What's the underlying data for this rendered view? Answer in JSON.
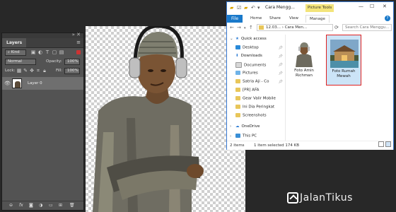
{
  "layers_panel": {
    "tab_label": "Layers",
    "kind_label": "Kind",
    "blend_mode": "Normal",
    "opacity_label": "Opacity:",
    "opacity_value": "100%",
    "lock_label": "Lock:",
    "fill_label": "Fill:",
    "fill_value": "100%",
    "layer_name": "Layer 0",
    "bottom_icons": [
      "link-icon",
      "fx-icon",
      "mask-icon",
      "adjustment-icon",
      "group-icon",
      "new-layer-icon",
      "trash-icon"
    ]
  },
  "explorer": {
    "title": "Cara Mengg...",
    "picture_tools": "Picture Tools",
    "tabs": [
      "File",
      "Home",
      "Share",
      "View",
      "Manage"
    ],
    "address": {
      "part1": "12.03...",
      "part2": "Cara Men..."
    },
    "search_placeholder": "Search Cara Menggu...",
    "nav_items": [
      {
        "label": "Quick access",
        "icon": "star-icon",
        "pinned": false
      },
      {
        "label": "Desktop",
        "icon": "desktop-icon",
        "pinned": true
      },
      {
        "label": "Downloads",
        "icon": "download-icon",
        "pinned": true
      },
      {
        "label": "Documents",
        "icon": "documents-icon",
        "pinned": true
      },
      {
        "label": "Pictures",
        "icon": "pictures-icon",
        "pinned": true
      },
      {
        "label": "Satria Aji - Co",
        "icon": "folder-icon",
        "pinned": true
      },
      {
        "label": "[PR] AFA",
        "icon": "folder-icon",
        "pinned": false
      },
      {
        "label": "Gear Valir Mobile",
        "icon": "folder-icon",
        "pinned": false
      },
      {
        "label": "Ini Dia Peringkat",
        "icon": "folder-icon",
        "pinned": false
      },
      {
        "label": "Screenshots",
        "icon": "folder-icon",
        "pinned": false
      },
      {
        "label": "OneDrive",
        "icon": "cloud-icon",
        "pinned": false
      },
      {
        "label": "This PC",
        "icon": "pc-icon",
        "pinned": false
      }
    ],
    "files": [
      {
        "name_line1": "Foto Amin",
        "name_line2": "Richman",
        "selected": false
      },
      {
        "name_line1": "Foto Rumah",
        "name_line2": "Mewah",
        "selected": true
      }
    ],
    "status": {
      "items": "2 items",
      "selected": "1 item selected  174 KB"
    }
  },
  "watermark": "JalanTikus",
  "colors": {
    "ps_bg": "#282828",
    "panel": "#535353",
    "selection_border": "#e02020",
    "file_tab": "#1979ca",
    "picture_tools": "#f3e47a"
  }
}
